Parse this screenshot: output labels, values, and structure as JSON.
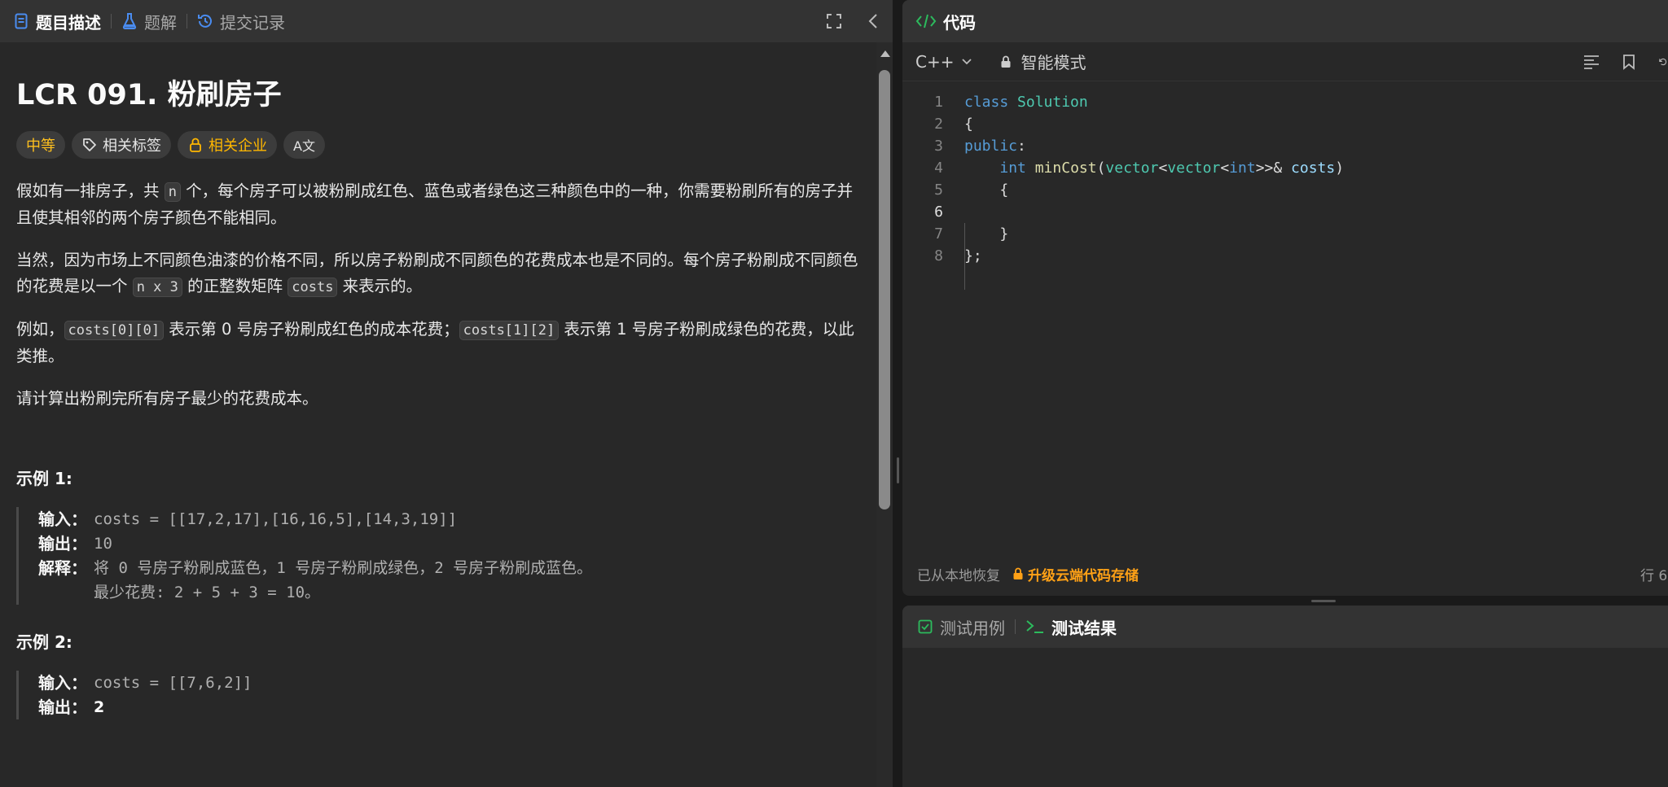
{
  "left_tabs": [
    {
      "label": "题目描述",
      "icon": "document-icon",
      "active": true
    },
    {
      "label": "题解",
      "icon": "flask-icon",
      "active": false
    },
    {
      "label": "提交记录",
      "icon": "history-icon",
      "active": false
    }
  ],
  "problem": {
    "title": "LCR 091. 粉刷房子",
    "tags": {
      "difficulty": "中等",
      "related_tags": "相关标签",
      "related_companies": "相关企业",
      "translate": "A文"
    },
    "p1": {
      "a": "假如有一排房子，共 ",
      "code": "n",
      "b": " 个，每个房子可以被粉刷成红色、蓝色或者绿色这三种颜色中的一种，你需要粉刷所有的房子并且使其相邻的两个房子颜色不能相同。"
    },
    "p2": {
      "a": "当然，因为市场上不同颜色油漆的价格不同，所以房子粉刷成不同颜色的花费成本也是不同的。每个房子粉刷成不同颜色的花费是以一个 ",
      "code1": "n x 3",
      "b": " 的正整数矩阵 ",
      "code2": "costs",
      "c": " 来表示的。"
    },
    "p3": {
      "a": "例如，",
      "code1": "costs[0][0]",
      "b": " 表示第 0 号房子粉刷成红色的成本花费；",
      "code2": "costs[1][2]",
      "c": " 表示第 1 号房子粉刷成绿色的花费，以此类推。"
    },
    "p4": "请计算出粉刷完所有房子最少的花费成本。",
    "example1": {
      "title": "示例 1:",
      "input_key": "输入：",
      "input": "costs = [[17,2,17],[16,16,5],[14,3,19]]",
      "output_key": "输出：",
      "output": "10",
      "explain_key": "解释：",
      "explain1": "将 0 号房子粉刷成蓝色，1 号房子粉刷成绿色，2 号房子粉刷成蓝色。",
      "explain2": "最少花费: 2 + 5 + 3 = 10。"
    },
    "example2": {
      "title": "示例 2:",
      "input_key": "输入：",
      "input": "costs = [[7,6,2]]",
      "output_key": "输出：",
      "output": "2"
    }
  },
  "code_panel": {
    "title": "代码",
    "language": "C++",
    "mode": "智能模式",
    "line_numbers": [
      "1",
      "2",
      "3",
      "4",
      "5",
      "6",
      "7",
      "8"
    ],
    "footer_status": "已从本地恢复",
    "footer_upgrade": "升级云端代码存储",
    "cursor_pos": "行 6"
  },
  "test_tabs": [
    {
      "label": "测试用例",
      "icon": "checkbox-icon",
      "active": false
    },
    {
      "label": "测试结果",
      "icon": "terminal-icon",
      "active": true
    }
  ],
  "colors": {
    "accent_orange": "#ffa116",
    "difficulty_medium": "#ffc01e",
    "code_green": "#2cbb5d",
    "tab_blue": "#4a8cf0"
  }
}
